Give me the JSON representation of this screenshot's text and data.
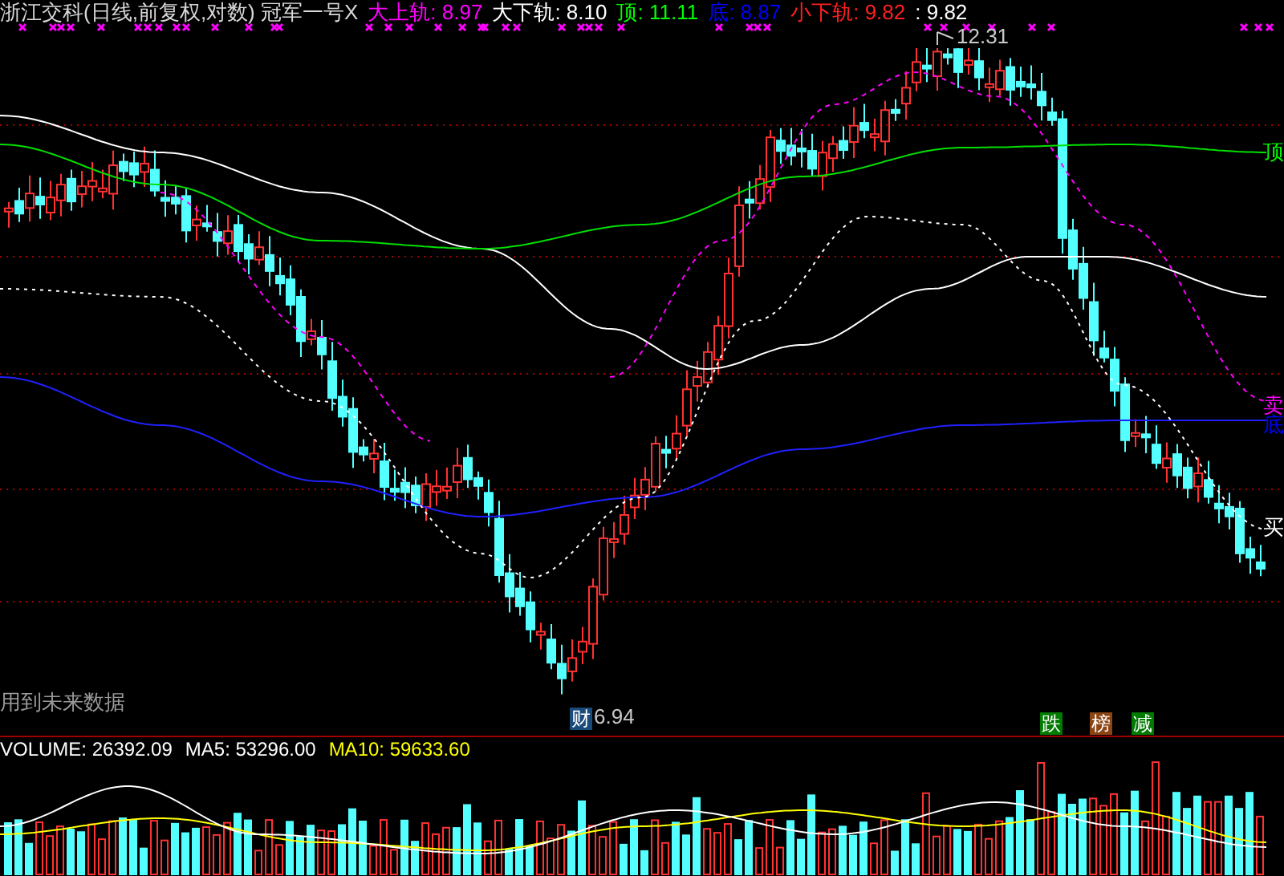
{
  "header": {
    "title": "浙江交科(日线,前复权,对数) 冠军一号X",
    "indicators": [
      {
        "label": "大上轨:",
        "value": "8.97",
        "color": "#ff00ff"
      },
      {
        "label": "大下轨:",
        "value": "8.10",
        "color": "#ffffff"
      },
      {
        "label": "顶:",
        "value": "11.11",
        "color": "#00ff00"
      },
      {
        "label": "底:",
        "value": "8.87",
        "color": "#0000ff"
      },
      {
        "label": "小下轨:",
        "value": "9.82",
        "color": "#ff2020"
      },
      {
        "label": ":",
        "value": "9.82",
        "color": "#ffffff"
      }
    ]
  },
  "price_high": {
    "value": "12.31"
  },
  "price_low": {
    "value": "6.94",
    "badge": "财"
  },
  "right_labels": [
    {
      "text": "顶",
      "color": "#00ff00"
    },
    {
      "text": "卖",
      "color": "#ff00ff"
    },
    {
      "text": "底",
      "color": "#0000ff"
    },
    {
      "text": "买",
      "color": "#ffffff"
    }
  ],
  "signals": [
    {
      "text": "跌",
      "color": "#007a00"
    },
    {
      "text": "榜",
      "color": "#8b4513"
    },
    {
      "text": "减",
      "color": "#007a00"
    }
  ],
  "note": "用到未来数据",
  "volume_header": [
    {
      "label": "VOLUME:",
      "value": "26392.09",
      "color": "#ffffff"
    },
    {
      "label": "MA5:",
      "value": "53296.00",
      "color": "#ffffff"
    },
    {
      "label": "MA10:",
      "value": "59633.60",
      "color": "#ffff00"
    }
  ]
}
